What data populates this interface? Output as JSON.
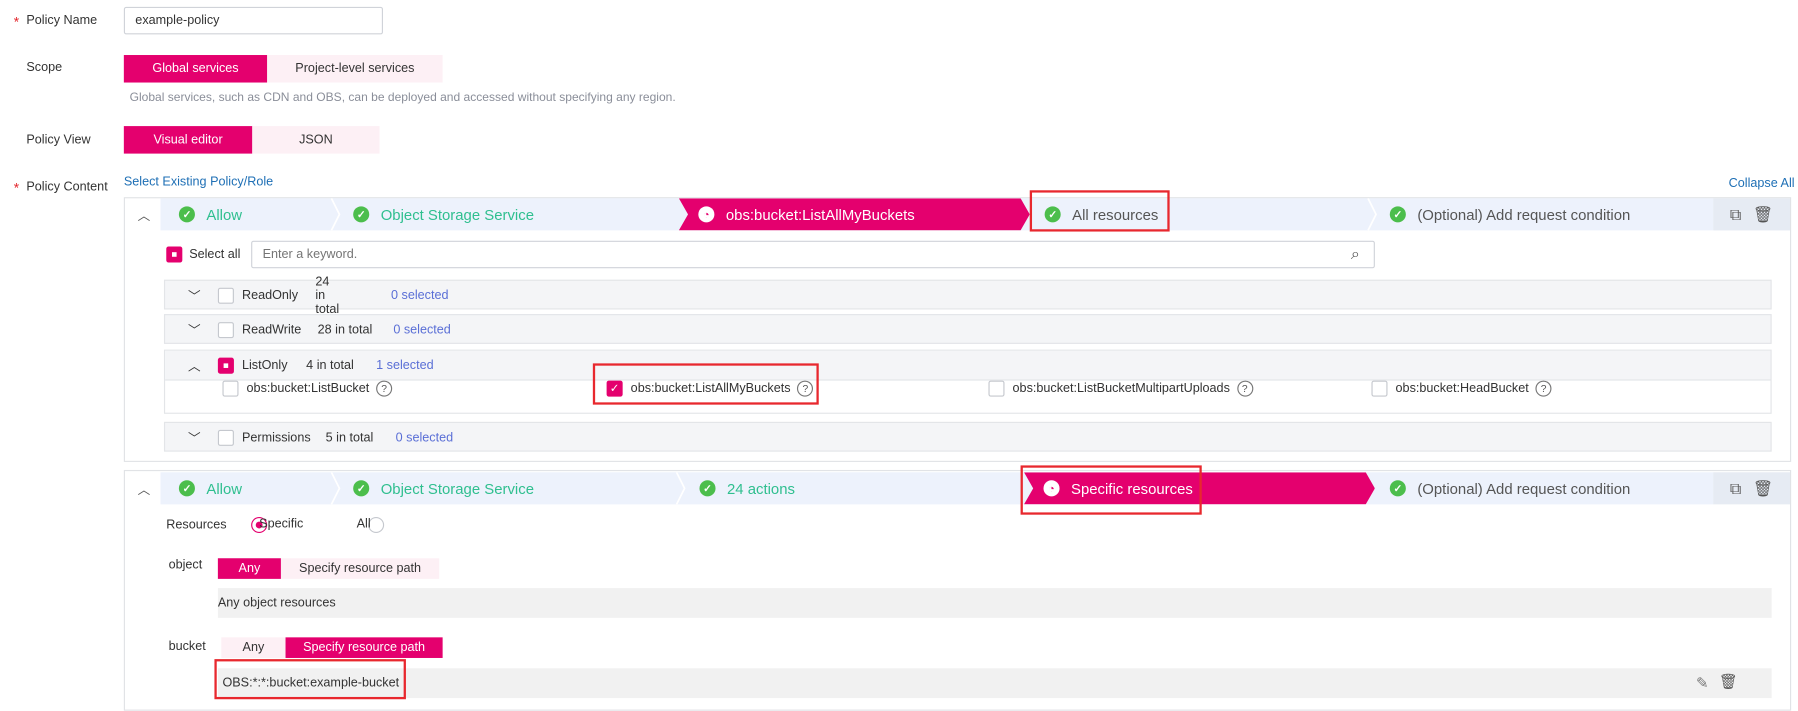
{
  "form": {
    "policy_name": {
      "label": "Policy Name",
      "value": "example-policy"
    },
    "scope": {
      "label": "Scope",
      "options": [
        "Global services",
        "Project-level services"
      ],
      "selected": "Global services",
      "hint": "Global services, such as CDN and OBS, can be deployed and accessed without specifying any region."
    },
    "policy_view": {
      "label": "Policy View",
      "options": [
        "Visual editor",
        "JSON"
      ],
      "selected": "Visual editor"
    },
    "policy_content": {
      "label": "Policy Content",
      "select_existing": "Select Existing Policy/Role",
      "collapse_all": "Collapse All"
    }
  },
  "colors": {
    "accent": "#e4006e",
    "step_ok": "#4cbe4c",
    "highlight": "#e8282e",
    "link": "#1e6fb5"
  },
  "statement1": {
    "steps": [
      "Allow",
      "Object Storage Service",
      "obs:bucket:ListAllMyBuckets",
      "All resources",
      "(Optional) Add request condition"
    ],
    "active_step": 2,
    "select_all": "Select all",
    "search_placeholder": "Enter a keyword.",
    "groups": [
      {
        "name": "ReadOnly",
        "total": "24 in total",
        "selected": "0 selected",
        "expanded": false
      },
      {
        "name": "ReadWrite",
        "total": "28 in total",
        "selected": "0 selected",
        "expanded": false
      },
      {
        "name": "ListOnly",
        "total": "4 in total",
        "selected": "1 selected",
        "expanded": true,
        "actions": [
          {
            "name": "obs:bucket:ListBucket",
            "checked": false
          },
          {
            "name": "obs:bucket:ListAllMyBuckets",
            "checked": true
          },
          {
            "name": "obs:bucket:ListBucketMultipartUploads",
            "checked": false
          },
          {
            "name": "obs:bucket:HeadBucket",
            "checked": false
          }
        ]
      },
      {
        "name": "Permissions",
        "total": "5 in total",
        "selected": "0 selected",
        "expanded": false
      }
    ]
  },
  "statement2": {
    "steps": [
      "Allow",
      "Object Storage Service",
      "24 actions",
      "Specific resources",
      "(Optional) Add request condition"
    ],
    "active_step": 3,
    "resources_label": "Resources",
    "resources_options": [
      "Specific",
      "All"
    ],
    "resources_selected": "Specific",
    "object": {
      "label": "object",
      "options": [
        "Any",
        "Specify resource path"
      ],
      "selected": "Any",
      "value": "Any object resources"
    },
    "bucket": {
      "label": "bucket",
      "options": [
        "Any",
        "Specify resource path"
      ],
      "selected": "Specify resource path",
      "value": "OBS:*:*:bucket:example-bucket"
    }
  }
}
